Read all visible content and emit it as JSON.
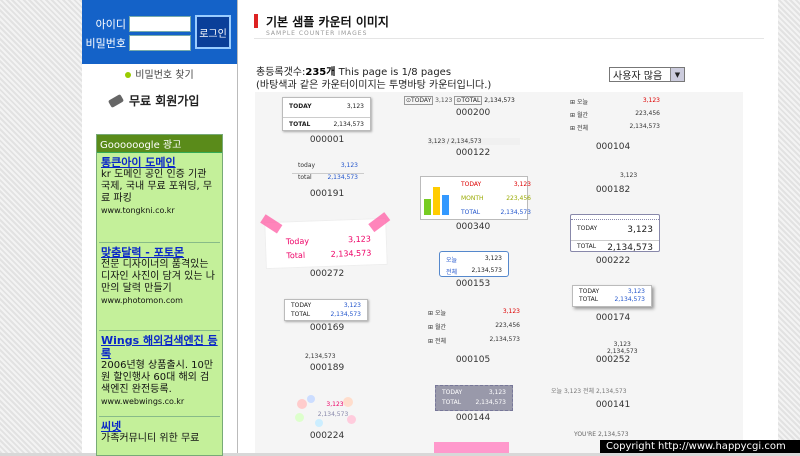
{
  "login": {
    "id_label": "아이디",
    "pw_label": "비밀번호",
    "button": "로그인",
    "find_pw": "비밀번호 찾기",
    "join": "무료 회원가입"
  },
  "ads": {
    "header": "Goooooogle 광고",
    "items": [
      {
        "title": "통큰아이 도메인",
        "desc": "kr 도메인 공인 인증 기관 국제, 국내 무료 포워딩, 무료 파킹",
        "url": "www.tongkni.co.kr"
      },
      {
        "title": "맞춤달력 - 포토몬",
        "desc": "전문 디자이너의 품격있는 디자인 사진이 담겨 있는 나만의 달력 만들기",
        "url": "www.photomon.com"
      },
      {
        "title": "Wings 해외검색엔진 등록",
        "desc": "2006년형 상품출시. 10만원 할인행사 60대 해외 검색엔진 완전등록.",
        "url": "www.webwings.co.kr"
      },
      {
        "title": "씨넷",
        "desc": "가족커뮤니티 위한 무료"
      }
    ]
  },
  "header": {
    "title": "기본 샘플 카운터 이미지",
    "subtitle": "SAMPLE COUNTER IMAGES"
  },
  "stats": {
    "label": "총등록갯수:",
    "count": "235개",
    "pages": " This page is 1/8 pages",
    "note": "(바탕색과 같은 카운터이미지는 투명바탕 카운터입니다.)"
  },
  "sort": {
    "selected": "사용자 많음"
  },
  "counters": [
    {
      "id": "000001"
    },
    {
      "id": "000200"
    },
    {
      "id": "000104"
    },
    {
      "id": "000191"
    },
    {
      "id": "000122"
    },
    {
      "id": "000182"
    },
    {
      "id": "000340"
    },
    {
      "id": "000272"
    },
    {
      "id": "000153"
    },
    {
      "id": "000222"
    },
    {
      "id": "000169"
    },
    {
      "id": "000174"
    },
    {
      "id": "000189"
    },
    {
      "id": "000105"
    },
    {
      "id": "000252"
    },
    {
      "id": "000224"
    },
    {
      "id": "000144"
    },
    {
      "id": "000141"
    }
  ],
  "samples": {
    "today": "TODAY",
    "total": "TOTAL",
    "t_small": "today",
    "tot_small": "total",
    "t_cap": "Today",
    "tot_cap": "Total",
    "v1": "3,123",
    "v2": "2,134,573",
    "month": "MONTH",
    "mv": "223,456",
    "ko_today": "오늘",
    "ko_yest": "월간",
    "ko_total": "전체",
    "inline": "3,123 / 2,134,573",
    "youre": "YOU'RE",
    "ko_inline": "오늘 3,123 전체 2,134,573"
  },
  "copyright": "Copyright  http://www.happycgi.com"
}
